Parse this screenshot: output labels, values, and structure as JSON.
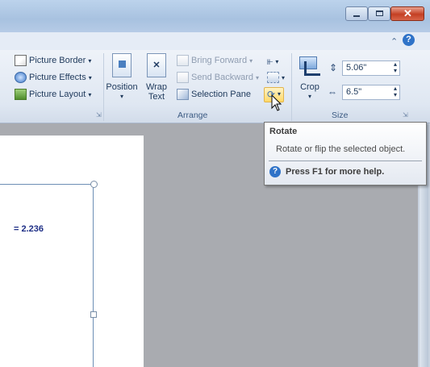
{
  "ribbon": {
    "picture_styles": {
      "border": "Picture Border",
      "effects": "Picture Effects",
      "layout": "Picture Layout"
    },
    "arrange": {
      "position": "Position",
      "wrap_line1": "Wrap",
      "wrap_line2": "Text",
      "bring_forward": "Bring Forward",
      "send_backward": "Send Backward",
      "selection_pane": "Selection Pane",
      "group_label": "Arrange"
    },
    "size": {
      "crop": "Crop",
      "height": "5.06\"",
      "width": "6.5\"",
      "group_label": "Size"
    }
  },
  "document": {
    "equation_text": "= 2.236"
  },
  "tooltip": {
    "title": "Rotate",
    "description": "Rotate or flip the selected object.",
    "help": "Press F1 for more help."
  }
}
